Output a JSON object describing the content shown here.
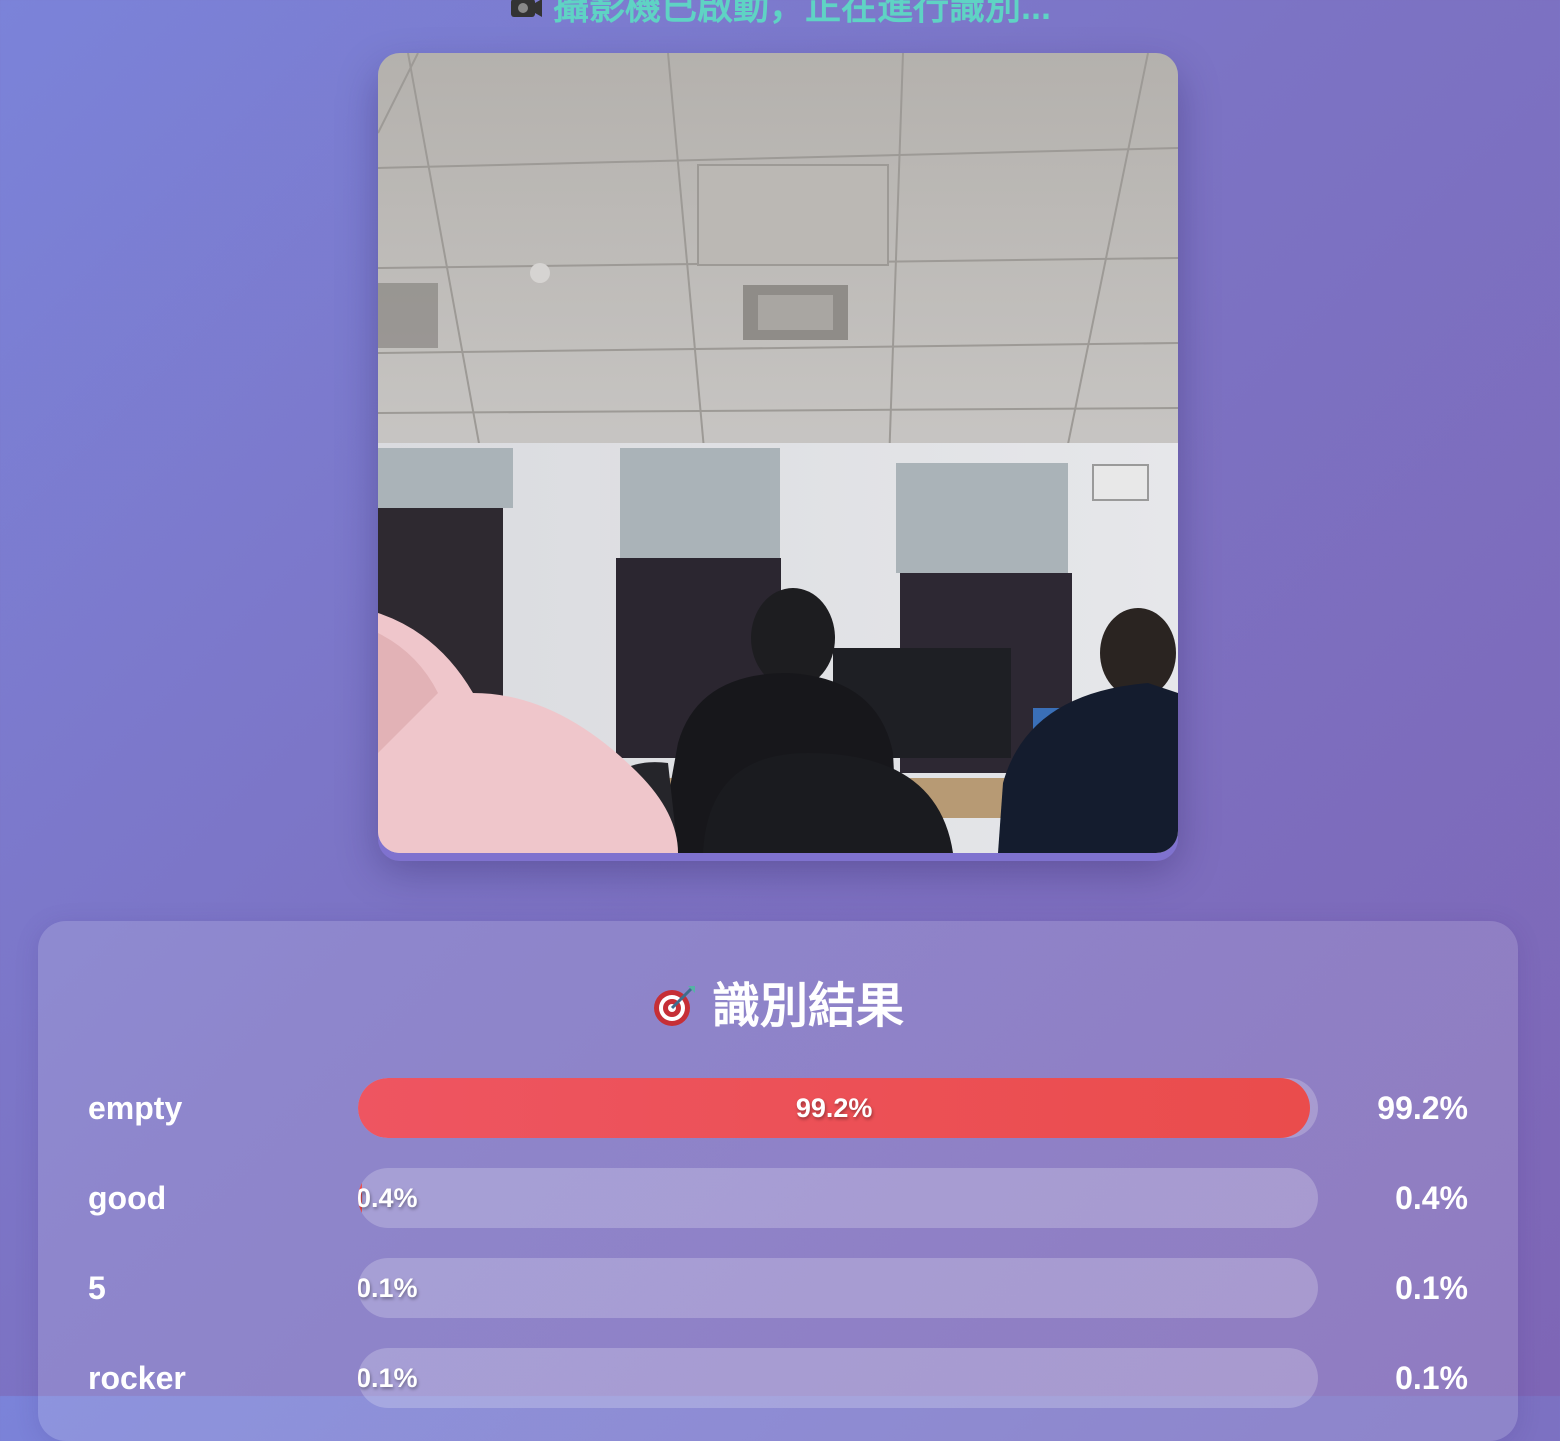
{
  "status": {
    "text": "攝影機已啟動，正在進行識別...",
    "icon": "camera-icon"
  },
  "camera": {
    "feed": "live-camera-feed"
  },
  "results": {
    "title": "識別結果",
    "title_icon": "target-icon",
    "items": [
      {
        "label": "empty",
        "percent_text": "99.2%",
        "bar_text": "99.2%",
        "value": 99.2
      },
      {
        "label": "good",
        "percent_text": "0.4%",
        "bar_text": "0.4%",
        "value": 0.4
      },
      {
        "label": "5",
        "percent_text": "0.1%",
        "bar_text": "0.1%",
        "value": 0.1
      },
      {
        "label": "rocker",
        "percent_text": "0.1%",
        "bar_text": "0.1%",
        "value": 0.1
      }
    ]
  },
  "colors": {
    "status_text": "#5fd3c4",
    "bar_fill": "#ea4c4c",
    "background": "#7c73c4"
  }
}
